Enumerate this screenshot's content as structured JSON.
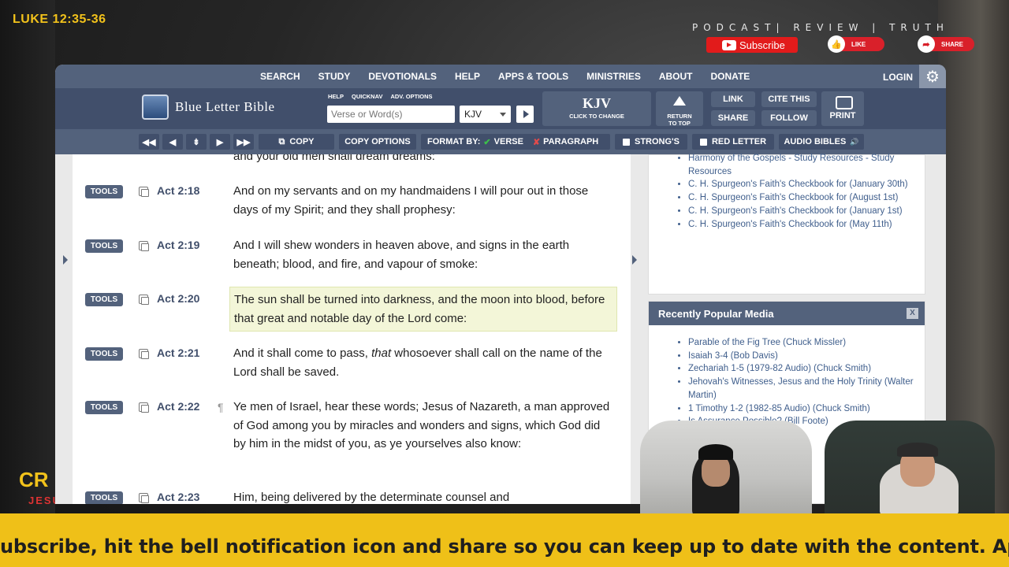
{
  "overlay": {
    "verse_ref": "LUKE 12:35-36",
    "tagline": "PODCAST|  REVIEW  |  TRUTH",
    "subscribe_label": "Subscribe",
    "like_label": "LIKE",
    "share_label": "SHARE",
    "cr_text": "CR",
    "jesus_text": "JESUS",
    "ticker_text": "ubscribe, hit the bell notification icon and share so you can keep up to date with the content.   Appre"
  },
  "topnav": {
    "links": [
      "SEARCH",
      "STUDY",
      "DEVOTIONALS",
      "HELP",
      "APPS & TOOLS",
      "MINISTRIES",
      "ABOUT",
      "DONATE"
    ],
    "login": "LOGIN",
    "gear": "⚙"
  },
  "mainbar": {
    "logo_text": "Blue Letter Bible",
    "mini_links": [
      "HELP",
      "QUICKNAV",
      "ADV. OPTIONS"
    ],
    "search_placeholder": "Verse or Word(s)",
    "version": "KJV",
    "kjv_big": "KJV",
    "kjv_small": "CLICK TO CHANGE",
    "return_line1": "RETURN",
    "return_line2": "TO TOP",
    "link": "LINK",
    "share": "SHARE",
    "cite": "CITE THIS",
    "follow": "FOLLOW",
    "print": "PRINT"
  },
  "toolbar": {
    "nav": [
      "◀◀",
      "◀",
      "⇟",
      "▶",
      "▶▶"
    ],
    "copy": "COPY",
    "copy_options": "COPY OPTIONS",
    "format_by": "FORMAT BY:",
    "verse": "VERSE",
    "paragraph": "PARAGRAPH",
    "strongs": "STRONG'S",
    "red_letter": "RED LETTER",
    "audio_bibles": "AUDIO BIBLES"
  },
  "verses": {
    "partial_top": "and your old men shall dream dreams:",
    "tools_label": "TOOLS",
    "items": [
      {
        "ref": "Act 2:18",
        "text": "And on my servants and on my handmaidens I will pour out in those days of my Spirit; and they shall prophesy:"
      },
      {
        "ref": "Act 2:19",
        "text": "And I will shew wonders in heaven above, and signs in the earth beneath; blood, and fire, and vapour of smoke:"
      },
      {
        "ref": "Act 2:20",
        "text": "The sun shall be turned into darkness, and the moon into blood, before that great and notable day of the Lord come:"
      },
      {
        "ref": "Act 2:21",
        "text_before": "And it shall come to pass, ",
        "text_italic": "that",
        "text_after": " whosoever shall call on the name of the Lord shall be saved."
      },
      {
        "ref": "Act 2:22",
        "pilcrow": "¶",
        "text": "Ye men of Israel, hear these words; Jesus of Nazareth, a man approved of God among you by miracles and wonders and signs, which God did by him in the midst of you, as ye yourselves also know:"
      },
      {
        "ref": "Act 2:23",
        "text": "Him, being delivered by the determinate counsel and"
      }
    ]
  },
  "sidebar": {
    "resources": [
      "Harmony of the Gospels - Study Resources - Study Resources",
      "C. H. Spurgeon's Faith's Checkbook for (January 30th)",
      "C. H. Spurgeon's Faith's Checkbook for (August 1st)",
      "C. H. Spurgeon's Faith's Checkbook for (January 1st)",
      "C. H. Spurgeon's Faith's Checkbook for (May 11th)"
    ],
    "media_title": "Recently Popular Media",
    "media_close": "X",
    "media": [
      "Parable of the Fig Tree (Chuck Missler)",
      "Isaiah 3-4 (Bob Davis)",
      "Zechariah 1-5 (1979-82 Audio) (Chuck Smith)",
      "Jehovah's Witnesses, Jesus and the Holy Trinity (Walter Martin)",
      "1 Timothy 1-2 (1982-85 Audio) (Chuck Smith)",
      "Is Assurance Possible? (Bill Foote)"
    ]
  }
}
